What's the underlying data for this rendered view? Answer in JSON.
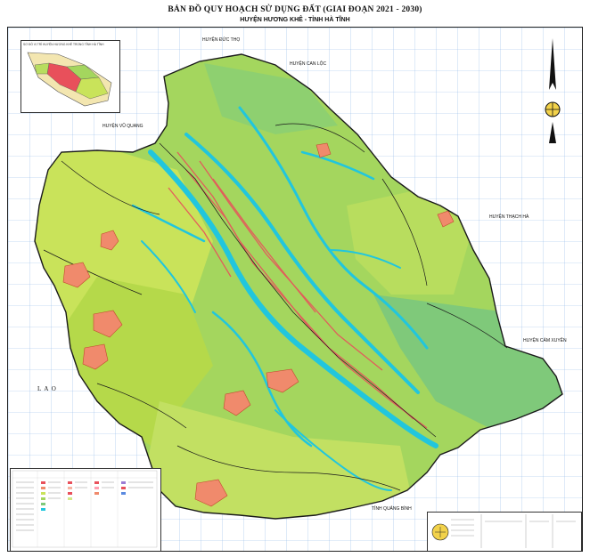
{
  "header": {
    "title": "BẢN ĐỒ QUY HOẠCH SỬ DỤNG ĐẤT (GIAI ĐOẠN 2021 - 2030)",
    "subtitle": "HUYỆN HƯƠNG KHÊ - TỈNH HÀ TĨNH"
  },
  "neighbors": {
    "north": "HUYỆN ĐỨC THỌ",
    "north_east": "HUYỆN CAN LỘC",
    "north_west": "HUYỆN VŨ QUANG",
    "east": "HUYỆN THẠCH HÀ",
    "south_east": "HUYỆN CẨM XUYÊN",
    "west": "L A O",
    "south": "TỈNH QUẢNG BÌNH"
  },
  "inset": {
    "title": "SƠ ĐỒ VỊ TRÍ HUYỆN HƯƠNG KHÊ TRONG TỈNH HÀ TĨNH"
  },
  "colors": {
    "grid": "#8fb7e8",
    "forest": "#a4d65e",
    "production_forest": "#c9e35a",
    "protection_forest": "#7fc97a",
    "river": "#21c6dd",
    "residential": "#e8505b",
    "boundary": "#1a1a1a",
    "salmon_zone": "#f08a6c"
  }
}
